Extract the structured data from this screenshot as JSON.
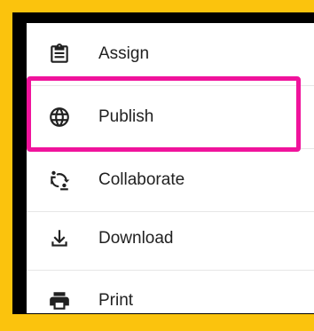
{
  "menu": {
    "items": [
      {
        "label": "Assign",
        "icon": "clipboard-icon"
      },
      {
        "label": "Publish",
        "icon": "globe-icon"
      },
      {
        "label": "Collaborate",
        "icon": "collaborate-icon"
      },
      {
        "label": "Download",
        "icon": "download-icon"
      },
      {
        "label": "Print",
        "icon": "printer-icon"
      }
    ],
    "highlighted_item": "Publish"
  },
  "colors": {
    "background": "#fbc30d",
    "frame": "#000000",
    "menu": "#ffffff",
    "highlight": "#f0139c",
    "text": "#212121"
  }
}
